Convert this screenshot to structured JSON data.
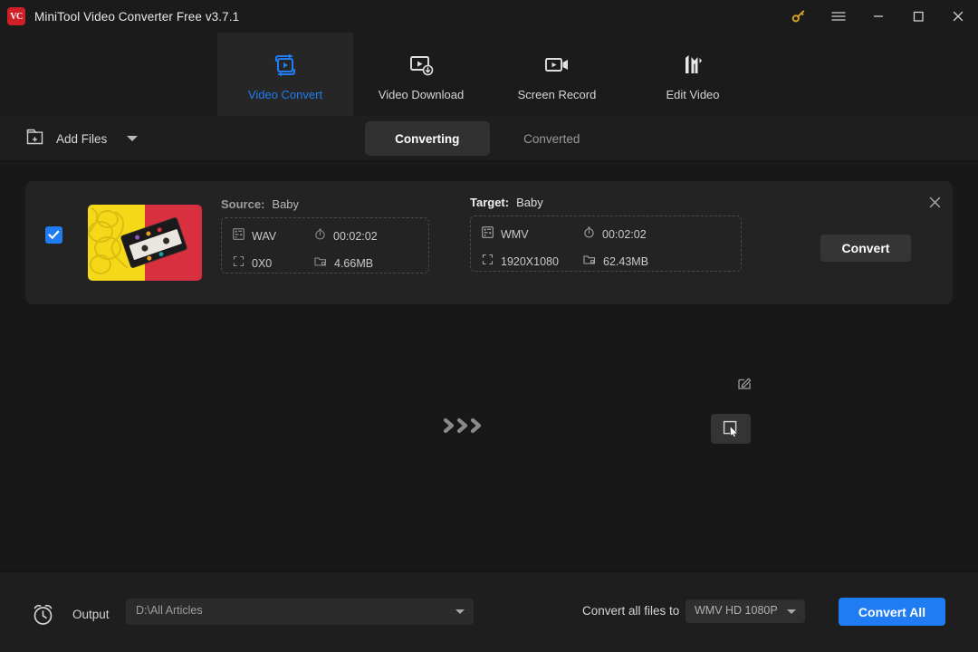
{
  "window": {
    "title": "MiniTool Video Converter Free v3.7.1",
    "logo_text": "VC",
    "controls": {
      "key": "key-icon",
      "menu": "hamburger-menu-icon",
      "minimize": "minimize-icon",
      "maximize": "maximize-icon",
      "close": "close-icon"
    }
  },
  "nav": {
    "tabs": [
      {
        "label": "Video Convert",
        "icon": "video-convert-icon",
        "active": true
      },
      {
        "label": "Video Download",
        "icon": "video-download-icon",
        "active": false
      },
      {
        "label": "Screen Record",
        "icon": "screen-record-icon",
        "active": false
      },
      {
        "label": "Edit Video",
        "icon": "edit-video-icon",
        "active": false
      }
    ]
  },
  "toolbar": {
    "add_files_label": "Add Files",
    "add_files_icon": "add-folder-icon",
    "segments": [
      {
        "label": "Converting",
        "active": true
      },
      {
        "label": "Converted",
        "active": false
      }
    ]
  },
  "file_card": {
    "checked": true,
    "thumbnail": "cassette-tape-thumbnail",
    "source": {
      "label": "Source:",
      "name": "Baby",
      "format": "WAV",
      "duration": "00:02:02",
      "resolution": "0X0",
      "size": "4.66MB"
    },
    "target": {
      "label": "Target:",
      "name": "Baby",
      "format": "WMV",
      "duration": "00:02:02",
      "resolution": "1920X1080",
      "size": "62.43MB"
    },
    "convert_label": "Convert",
    "edit_icon": "edit-pencil-icon",
    "close_icon": "remove-file-icon",
    "arrows_icon": "triple-chevron-right-icon",
    "cursor_button_icon": "select-cursor-icon"
  },
  "bottom": {
    "clock_icon": "alarm-clock-icon",
    "output_label": "Output",
    "output_path": "D:\\All Articles",
    "convert_all_to_label": "Convert all files to",
    "format_value": "WMV HD 1080P",
    "convert_all_label": "Convert All"
  },
  "colors": {
    "accent": "#1f7cf2",
    "logo_red": "#cf2027",
    "key_gold": "#d9a520",
    "window_bg": "#181818",
    "panel_bg": "#1b1b1b",
    "card_bg": "#232323"
  }
}
